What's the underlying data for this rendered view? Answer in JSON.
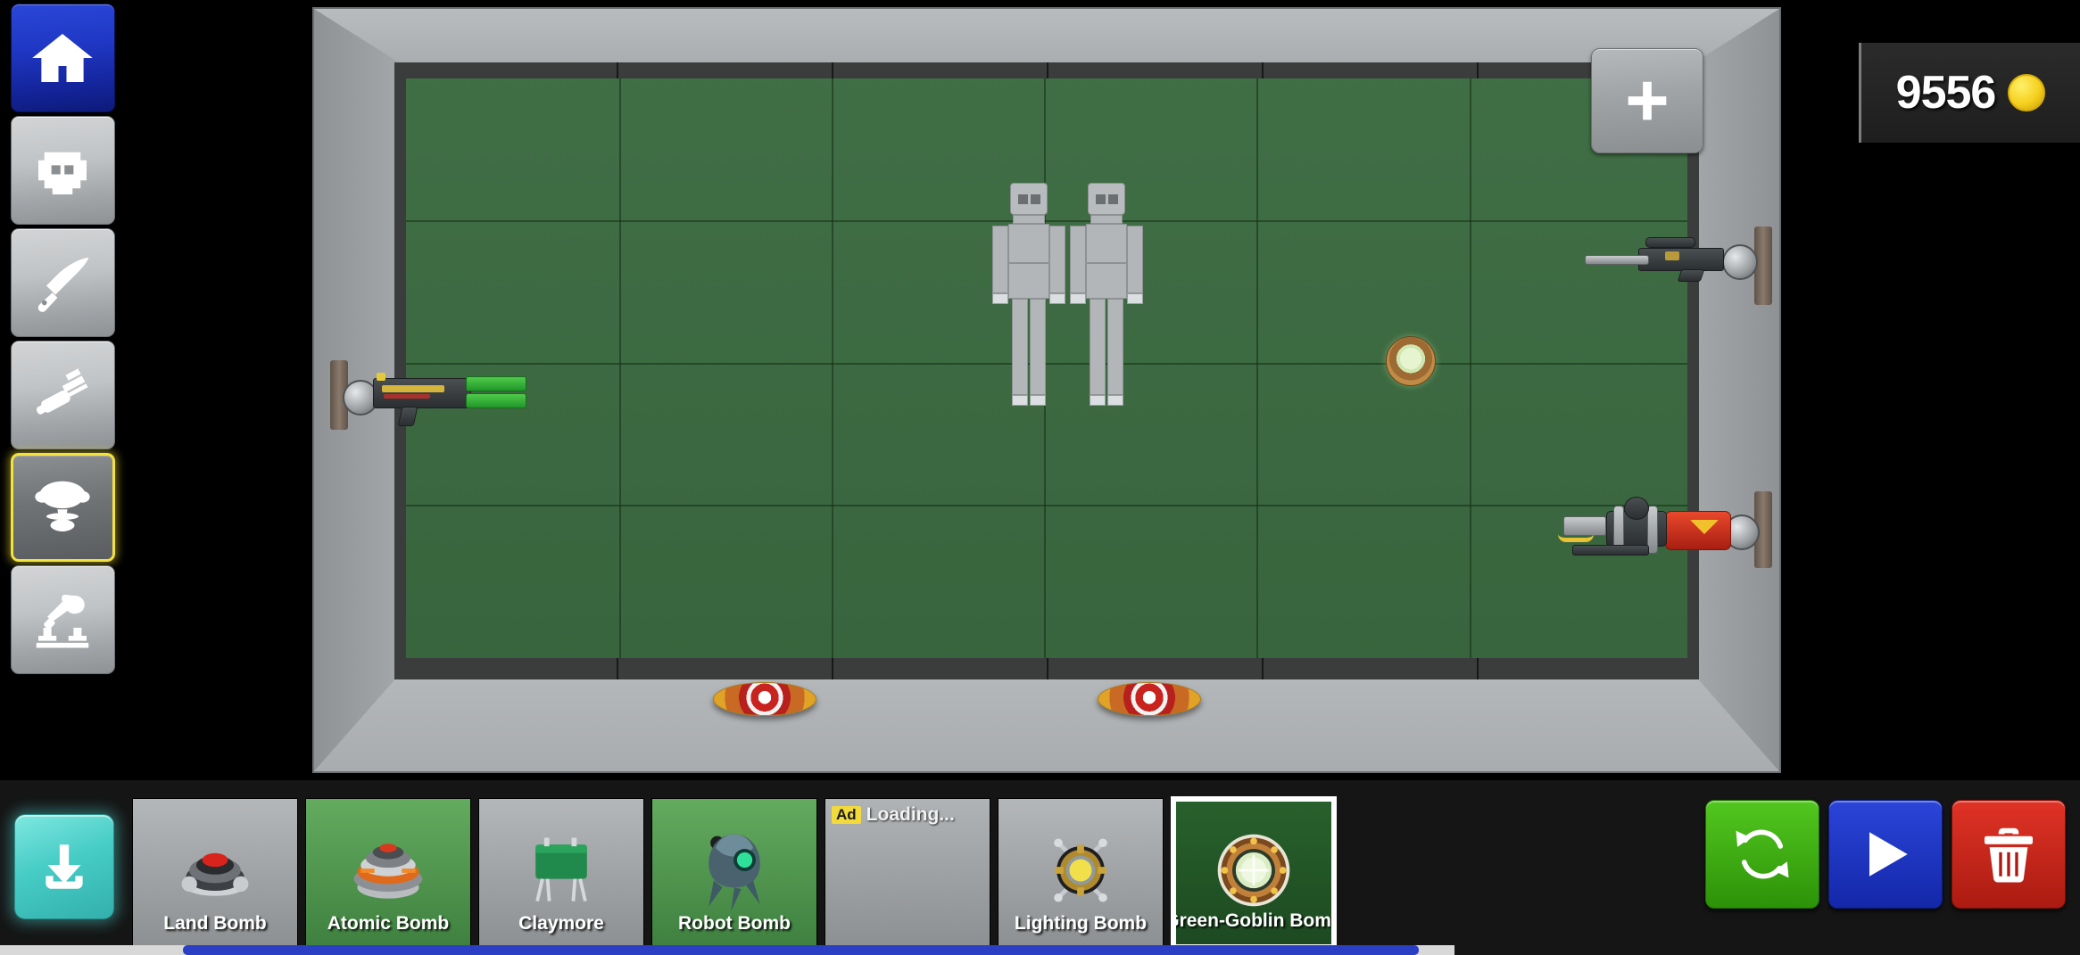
{
  "currency": {
    "amount": "9556",
    "icon": "coin-icon"
  },
  "category_rail": {
    "items": [
      {
        "id": "home",
        "icon": "home-icon",
        "label": "Home",
        "state": "home"
      },
      {
        "id": "ragdoll",
        "icon": "robot-head-icon",
        "label": "Ragdolls",
        "state": "normal"
      },
      {
        "id": "melee",
        "icon": "knife-icon",
        "label": "Melee",
        "state": "normal"
      },
      {
        "id": "guns",
        "icon": "gun-icon",
        "label": "Guns",
        "state": "normal"
      },
      {
        "id": "bombs",
        "icon": "explosion-icon",
        "label": "Bombs",
        "state": "selected"
      },
      {
        "id": "machines",
        "icon": "robot-arm-icon",
        "label": "Machines",
        "state": "normal"
      }
    ]
  },
  "arena": {
    "add_button": {
      "icon": "plus-icon",
      "label": "+"
    },
    "ragdolls": [
      {
        "name": "ragdoll-1"
      },
      {
        "name": "ragdoll-2"
      }
    ],
    "weapons": [
      {
        "name": "green-barrel-gun",
        "wall": "left",
        "type": "minigun"
      },
      {
        "name": "sniper-rifle",
        "wall": "right",
        "type": "sniper"
      },
      {
        "name": "flamethrower",
        "wall": "right",
        "type": "flamethrower"
      }
    ],
    "placed_objects": [
      {
        "name": "land-mine-1",
        "type": "mine"
      },
      {
        "name": "land-mine-2",
        "type": "mine"
      },
      {
        "name": "green-goblin-bomb-1",
        "type": "green-goblin-bomb"
      }
    ]
  },
  "bottom_bar": {
    "download_button": {
      "icon": "download-icon",
      "label": "Download"
    },
    "items": [
      {
        "label": "Land Bomb",
        "art": "land-bomb",
        "state": "locked",
        "icon": "land-bomb-icon"
      },
      {
        "label": "Atomic Bomb",
        "art": "atomic-bomb",
        "state": "owned",
        "icon": "atomic-bomb-icon"
      },
      {
        "label": "Claymore",
        "art": "claymore",
        "state": "locked",
        "icon": "claymore-icon"
      },
      {
        "label": "Robot Bomb",
        "art": "robot-bomb",
        "state": "owned",
        "icon": "robot-bomb-icon"
      },
      {
        "label": "",
        "art": "ad",
        "state": "ad",
        "icon": "ad-slot-icon",
        "ad_badge": "Ad",
        "ad_text": "Loading..."
      },
      {
        "label": "Lighting Bomb",
        "art": "lighting-bomb",
        "state": "locked",
        "icon": "lighting-bomb-icon"
      },
      {
        "label": "Green-Goblin Bomb",
        "art": "green-goblin-bomb",
        "state": "selected",
        "icon": "green-goblin-bomb-icon"
      }
    ],
    "actions": [
      {
        "id": "reset",
        "icon": "refresh-icon",
        "label": "Reset"
      },
      {
        "id": "play",
        "icon": "play-icon",
        "label": "Play"
      },
      {
        "id": "clear",
        "icon": "trash-icon",
        "label": "Clear"
      }
    ]
  },
  "colors": {
    "home_blue": "#1f37c4",
    "selected_yellow": "#f3e23c",
    "arena_green": "#3c6b41",
    "owned_green": "#4f9a4b",
    "ad_yellow": "#f2d93c",
    "reset_green": "#2c9208",
    "play_blue": "#1327a8",
    "trash_red": "#ab1b11",
    "download_cyan": "#47ccc6",
    "scrollbar_blue": "#2b3fc4"
  }
}
